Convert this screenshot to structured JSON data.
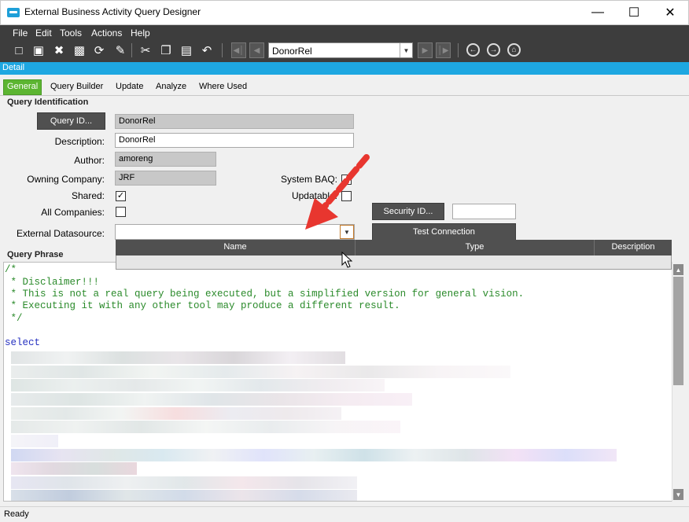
{
  "window": {
    "title": "External Business Activity Query Designer"
  },
  "menu": [
    "File",
    "Edit",
    "Tools",
    "Actions",
    "Help"
  ],
  "toolbar": {
    "navigator_value": "DonorRel"
  },
  "detail_bar": "Detail",
  "tabs": [
    "General",
    "Query Builder",
    "Update",
    "Analyze",
    "Where Used"
  ],
  "query_identification": {
    "section_title": "Query Identification",
    "query_id_button": "Query ID...",
    "query_id_value": "DonorRel",
    "description_label": "Description:",
    "description_value": "DonorRel",
    "author_label": "Author:",
    "author_value": "amoreng",
    "owning_company_label": "Owning Company:",
    "owning_company_value": "JRF",
    "shared_label": "Shared:",
    "shared_checked": true,
    "all_companies_label": "All Companies:",
    "all_companies_checked": false,
    "system_baq_label": "System BAQ:",
    "updatable_label": "Updatable:",
    "updatable_checked": false,
    "security_id_button": "Security ID...",
    "security_id_value": "",
    "test_connection_button": "Test Connection",
    "external_datasource_label": "External Datasource:",
    "external_datasource_value": ""
  },
  "datasource_dropdown": {
    "columns": [
      "Name",
      "Type",
      "Description"
    ]
  },
  "query_phrase": {
    "section_title": "Query Phrase",
    "comment_lines": [
      "/*",
      " * Disclaimer!!!",
      " * This is not a real query being executed, but a simplified version for general vision.",
      " * Executing it with any other tool may produce a different result.",
      " */"
    ],
    "keyword": "select"
  },
  "status": {
    "text": "Ready"
  },
  "colors": {
    "accent_blue": "#1ea7e1",
    "tab_green": "#5cb531",
    "dark_chrome": "#3d3d3d",
    "arrow_red": "#e8362f"
  }
}
